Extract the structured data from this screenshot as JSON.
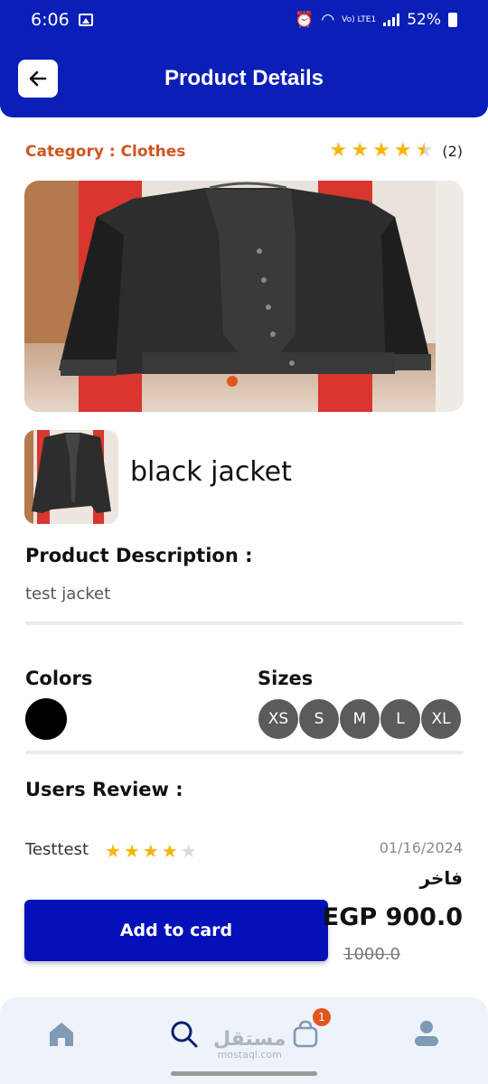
{
  "status_bar": {
    "time": "6:06",
    "network": "Vo) LTE1",
    "battery": "52%"
  },
  "header": {
    "title": "Product Details",
    "back_icon": "arrow-left-icon"
  },
  "category": {
    "label": "Category : Clothes"
  },
  "rating": {
    "stars": 4.5,
    "max": 5,
    "count": "(2)"
  },
  "product": {
    "name": "black jacket",
    "description_title": "Product Description :",
    "description": "test jacket"
  },
  "colors": {
    "title": "Colors",
    "items": [
      "#000000"
    ]
  },
  "sizes": {
    "title": "Sizes",
    "items": [
      "XS",
      "S",
      "M",
      "L",
      "XL"
    ]
  },
  "reviews": {
    "title": "Users Review :",
    "items": [
      {
        "user": "Testtest",
        "stars": 4,
        "date": "01/16/2024",
        "text": "فاخر"
      }
    ]
  },
  "purchase": {
    "button_label": "Add to card",
    "price": "EGP 900.0",
    "old_price": "1000.0"
  },
  "bottom_nav": {
    "items": [
      "home-icon",
      "search-icon",
      "cart-icon",
      "profile-icon"
    ],
    "cart_badge": "1"
  },
  "watermark": {
    "arabic": "مستقل",
    "latin": "mostaql.com"
  },
  "colors_theme": {
    "primary": "#0a1fb8",
    "accent": "#e0561f",
    "star": "#f5b50a"
  }
}
